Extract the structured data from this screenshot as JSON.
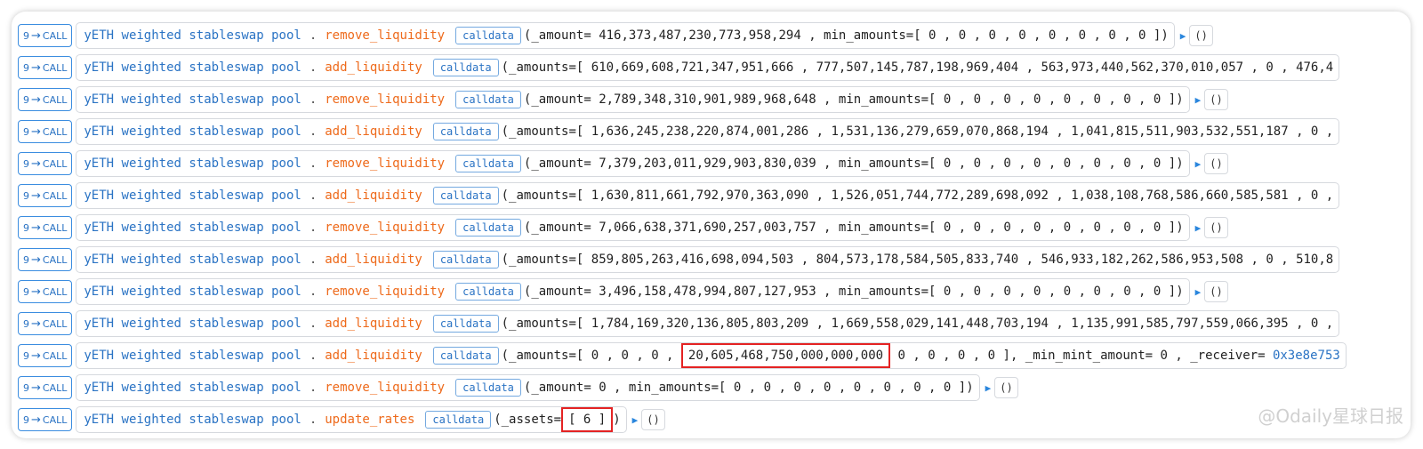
{
  "colors": {
    "contract": "#2a73c4",
    "function": "#ee6a1b",
    "badge_border": "#3b8de0",
    "highlight": "#e42323"
  },
  "icons": {
    "arrow": "right-arrow-icon",
    "expand": "play-triangle-icon"
  },
  "watermark": "@Odaily星球日报",
  "rows": [
    {
      "badge_depth": "9",
      "badge_arrow": "→",
      "badge_type": "CALL",
      "contract": "yETH weighted stableswap pool",
      "dot": ".",
      "function": "remove_liquidity",
      "calldata_label": "calldata",
      "args": "(_amount= 416,373,487,230,773,958,294 , min_amounts=[ 0 ,  0 ,  0 ,  0 ,  0 ,  0 ,  0 ,  0 ])",
      "return": "()"
    },
    {
      "badge_depth": "9",
      "badge_arrow": "→",
      "badge_type": "CALL",
      "contract": "yETH weighted stableswap pool",
      "dot": ".",
      "function": "add_liquidity",
      "calldata_label": "calldata",
      "args": "(_amounts=[ 610,669,608,721,347,951,666 ,  777,507,145,787,198,969,404 ,  563,973,440,562,370,010,057 ,  0 ,  476,4"
    },
    {
      "badge_depth": "9",
      "badge_arrow": "→",
      "badge_type": "CALL",
      "contract": "yETH weighted stableswap pool",
      "dot": ".",
      "function": "remove_liquidity",
      "calldata_label": "calldata",
      "args": "(_amount= 2,789,348,310,901,989,968,648 , min_amounts=[ 0 ,  0 ,  0 ,  0 ,  0 ,  0 ,  0 ,  0 ])",
      "return": "()"
    },
    {
      "badge_depth": "9",
      "badge_arrow": "→",
      "badge_type": "CALL",
      "contract": "yETH weighted stableswap pool",
      "dot": ".",
      "function": "add_liquidity",
      "calldata_label": "calldata",
      "args": "(_amounts=[ 1,636,245,238,220,874,001,286 ,  1,531,136,279,659,070,868,194 ,  1,041,815,511,903,532,551,187 ,  0 ,"
    },
    {
      "badge_depth": "9",
      "badge_arrow": "→",
      "badge_type": "CALL",
      "contract": "yETH weighted stableswap pool",
      "dot": ".",
      "function": "remove_liquidity",
      "calldata_label": "calldata",
      "args": "(_amount= 7,379,203,011,929,903,830,039 , min_amounts=[ 0 ,  0 ,  0 ,  0 ,  0 ,  0 ,  0 ,  0 ])",
      "return": "()"
    },
    {
      "badge_depth": "9",
      "badge_arrow": "→",
      "badge_type": "CALL",
      "contract": "yETH weighted stableswap pool",
      "dot": ".",
      "function": "add_liquidity",
      "calldata_label": "calldata",
      "args": "(_amounts=[ 1,630,811,661,792,970,363,090 ,  1,526,051,744,772,289,698,092 ,  1,038,108,768,586,660,585,581 ,  0 ,"
    },
    {
      "badge_depth": "9",
      "badge_arrow": "→",
      "badge_type": "CALL",
      "contract": "yETH weighted stableswap pool",
      "dot": ".",
      "function": "remove_liquidity",
      "calldata_label": "calldata",
      "args": "(_amount= 7,066,638,371,690,257,003,757 , min_amounts=[ 0 ,  0 ,  0 ,  0 ,  0 ,  0 ,  0 ,  0 ])",
      "return": "()"
    },
    {
      "badge_depth": "9",
      "badge_arrow": "→",
      "badge_type": "CALL",
      "contract": "yETH weighted stableswap pool",
      "dot": ".",
      "function": "add_liquidity",
      "calldata_label": "calldata",
      "args": "(_amounts=[ 859,805,263,416,698,094,503 ,  804,573,178,584,505,833,740 ,  546,933,182,262,586,953,508 ,  0 ,  510,8"
    },
    {
      "badge_depth": "9",
      "badge_arrow": "→",
      "badge_type": "CALL",
      "contract": "yETH weighted stableswap pool",
      "dot": ".",
      "function": "remove_liquidity",
      "calldata_label": "calldata",
      "args": "(_amount= 3,496,158,478,994,807,127,953 , min_amounts=[ 0 ,  0 ,  0 ,  0 ,  0 ,  0 ,  0 ,  0 ])",
      "return": "()"
    },
    {
      "badge_depth": "9",
      "badge_arrow": "→",
      "badge_type": "CALL",
      "contract": "yETH weighted stableswap pool",
      "dot": ".",
      "function": "add_liquidity",
      "calldata_label": "calldata",
      "args": "(_amounts=[ 1,784,169,320,136,805,803,209 ,  1,669,558,029,141,448,703,194 ,  1,135,991,585,797,559,066,395 ,  0 ,"
    },
    {
      "badge_depth": "9",
      "badge_arrow": "→",
      "badge_type": "CALL",
      "contract": "yETH weighted stableswap pool",
      "dot": ".",
      "function": "add_liquidity",
      "calldata_label": "calldata",
      "args_pre": "(_amounts=[ 0 ,  0 ,  0 , ",
      "args_hl": "20,605,468,750,000,000,000",
      "args_post": "  0 ,  0 ,  0 ,  0 ], _min_mint_amount= 0 , _receiver= ",
      "args_addr": "0x3e8e753"
    },
    {
      "badge_depth": "9",
      "badge_arrow": "→",
      "badge_type": "CALL",
      "contract": "yETH weighted stableswap pool",
      "dot": ".",
      "function": "remove_liquidity",
      "calldata_label": "calldata",
      "args": "(_amount= 0 , min_amounts=[ 0 ,  0 ,  0 ,  0 ,  0 ,  0 ,  0 ,  0 ])",
      "return": "()"
    },
    {
      "badge_depth": "9",
      "badge_arrow": "→",
      "badge_type": "CALL",
      "contract": "yETH weighted stableswap pool",
      "dot": ".",
      "function": "update_rates",
      "calldata_label": "calldata",
      "args_pre": "(_assets=",
      "args_hl": "[ 6 ]",
      "args_post": ")",
      "return": "()"
    }
  ]
}
